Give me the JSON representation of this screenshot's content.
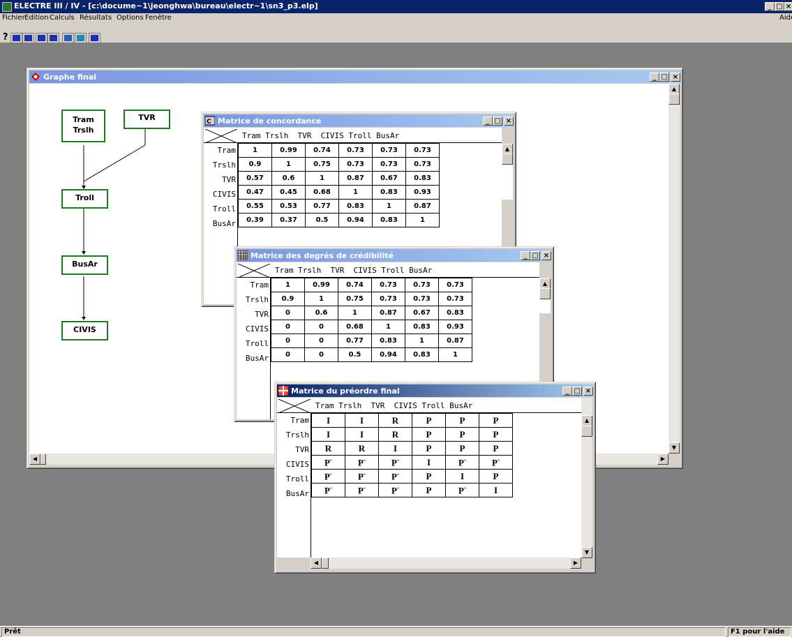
{
  "app": {
    "title": "ELECTRE  III / IV - [c:\\docume~1\\jeonghwa\\bureau\\electr~1\\sn3_p3.elp]",
    "help_label": "Aide"
  },
  "menu": [
    "Fichier",
    "Edition",
    "Calculs",
    "Résultats",
    "Options",
    "Fenêtre"
  ],
  "toolbar": {
    "help_glyph": "?"
  },
  "status": {
    "left": "Prêt",
    "right": "F1 pour l'aide"
  },
  "graph_window": {
    "title": "Graphe final",
    "nodes": [
      {
        "id": "tram",
        "lines": [
          "Tram",
          "Trslh"
        ]
      },
      {
        "id": "tvr",
        "lines": [
          "TVR"
        ]
      },
      {
        "id": "troll",
        "lines": [
          "Troll"
        ]
      },
      {
        "id": "busar",
        "lines": [
          "BusAr"
        ]
      },
      {
        "id": "civis",
        "lines": [
          "CIVIS"
        ]
      }
    ]
  },
  "concordance": {
    "title": "Matrice de concordance",
    "columns": [
      "Tram",
      "Trslh",
      "TVR",
      "CIVIS",
      "Troll",
      "BusAr"
    ],
    "rows": [
      "Tram",
      "Trslh",
      "TVR",
      "CIVIS",
      "Troll",
      "BusAr"
    ],
    "values": [
      [
        "1",
        "0.99",
        "0.74",
        "0.73",
        "0.73",
        "0.73"
      ],
      [
        "0.9",
        "1",
        "0.75",
        "0.73",
        "0.73",
        "0.73"
      ],
      [
        "0.57",
        "0.6",
        "1",
        "0.87",
        "0.67",
        "0.83"
      ],
      [
        "0.47",
        "0.45",
        "0.68",
        "1",
        "0.83",
        "0.93"
      ],
      [
        "0.55",
        "0.53",
        "0.77",
        "0.83",
        "1",
        "0.87"
      ],
      [
        "0.39",
        "0.37",
        "0.5",
        "0.94",
        "0.83",
        "1"
      ]
    ]
  },
  "credibility": {
    "title": "Matrice des degrés de crédibilité",
    "columns": [
      "Tram",
      "Trslh",
      "TVR",
      "CIVIS",
      "Troll",
      "BusAr"
    ],
    "rows": [
      "Tram",
      "Trslh",
      "TVR",
      "CIVIS",
      "Troll",
      "BusAr"
    ],
    "values": [
      [
        "1",
        "0.99",
        "0.74",
        "0.73",
        "0.73",
        "0.73"
      ],
      [
        "0.9",
        "1",
        "0.75",
        "0.73",
        "0.73",
        "0.73"
      ],
      [
        "0",
        "0.6",
        "1",
        "0.87",
        "0.67",
        "0.83"
      ],
      [
        "0",
        "0",
        "0.68",
        "1",
        "0.83",
        "0.93"
      ],
      [
        "0",
        "0",
        "0.77",
        "0.83",
        "1",
        "0.87"
      ],
      [
        "0",
        "0",
        "0.5",
        "0.94",
        "0.83",
        "1"
      ]
    ]
  },
  "preorder": {
    "title": "Matrice du préordre final",
    "columns": [
      "Tram",
      "Trslh",
      "TVR",
      "CIVIS",
      "Troll",
      "BusAr"
    ],
    "rows": [
      "Tram",
      "Trslh",
      "TVR",
      "CIVIS",
      "Troll",
      "BusAr"
    ],
    "values": [
      [
        "I",
        "I",
        "R",
        "P",
        "P",
        "P"
      ],
      [
        "I",
        "I",
        "R",
        "P",
        "P",
        "P"
      ],
      [
        "R",
        "R",
        "I",
        "P",
        "P",
        "P"
      ],
      [
        "P-",
        "P-",
        "P-",
        "I",
        "P-",
        "P-"
      ],
      [
        "P-",
        "P-",
        "P-",
        "P",
        "I",
        "P"
      ],
      [
        "P-",
        "P-",
        "P-",
        "P",
        "P-",
        "I"
      ]
    ]
  },
  "colors": {
    "title_active": "#0a246a",
    "node_border": "#1e7a1e",
    "desktop": "#808080"
  }
}
